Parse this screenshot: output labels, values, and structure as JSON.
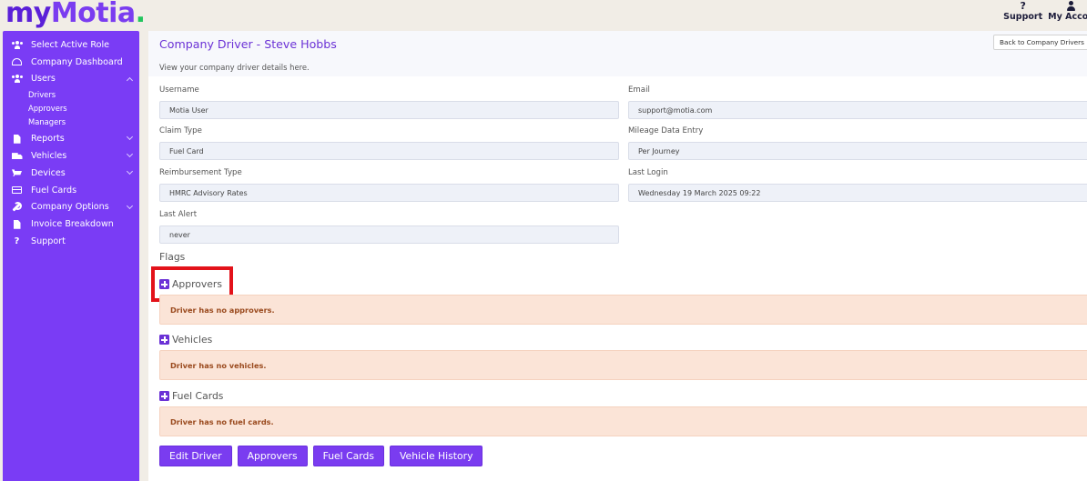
{
  "brand": {
    "my": "my",
    "motia": "Motia",
    "dot": "."
  },
  "toplinks": {
    "support": "Support",
    "account": "My Accou"
  },
  "sidebar": {
    "select_role": "Select Active Role",
    "dashboard": "Company Dashboard",
    "users": "Users",
    "users_sub": [
      "Drivers",
      "Approvers",
      "Managers"
    ],
    "reports": "Reports",
    "vehicles": "Vehicles",
    "devices": "Devices",
    "fuel_cards": "Fuel Cards",
    "company_options": "Company Options",
    "invoice": "Invoice Breakdown",
    "support": "Support"
  },
  "page": {
    "title": "Company Driver - Steve Hobbs",
    "subtitle": "View your company driver details here.",
    "back_button": "Back to Company Drivers"
  },
  "fields": {
    "username": {
      "label": "Username",
      "value": "Motia User"
    },
    "email": {
      "label": "Email",
      "value": "support@motia.com"
    },
    "claim_type": {
      "label": "Claim Type",
      "value": "Fuel Card"
    },
    "mileage": {
      "label": "Mileage Data Entry",
      "value": "Per Journey"
    },
    "reimbursement": {
      "label": "Reimbursement Type",
      "value": "HMRC Advisory Rates"
    },
    "last_login": {
      "label": "Last Login",
      "value": "Wednesday 19 March 2025 09:22"
    },
    "last_alert": {
      "label": "Last Alert",
      "value": "never"
    }
  },
  "flags": {
    "title": "Flags",
    "approvers": {
      "label": "Approvers",
      "message": "Driver has no approvers."
    },
    "vehicles": {
      "label": "Vehicles",
      "message": "Driver has no vehicles."
    },
    "fuel_cards": {
      "label": "Fuel Cards",
      "message": "Driver has no fuel cards."
    }
  },
  "actions": {
    "edit": "Edit Driver",
    "approvers": "Approvers",
    "fuel_cards": "Fuel Cards",
    "vehicle_history": "Vehicle History"
  },
  "colors": {
    "accent": "#7a3cf5",
    "highlight": "#e3121a",
    "alert_bg": "#fbe4d7"
  }
}
